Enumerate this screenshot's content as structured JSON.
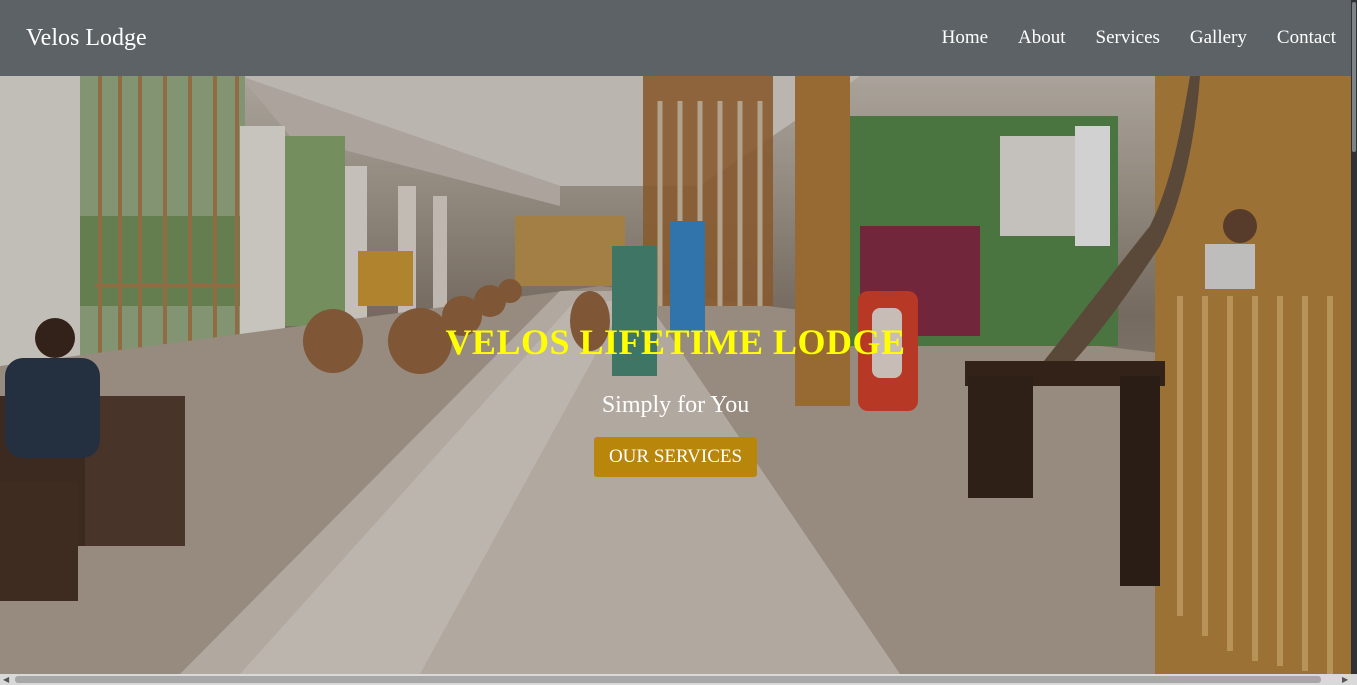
{
  "navbar": {
    "brand": "Velos Lodge",
    "links": [
      "Home",
      "About",
      "Services",
      "Gallery",
      "Contact"
    ]
  },
  "hero": {
    "title": "VELOS LIFETIME LODGE",
    "subtitle": "Simply for You",
    "cta_label": "OUR SERVICES"
  },
  "colors": {
    "navbar": "#5c6266",
    "title": "#ffff00",
    "cta": "#b8860b"
  },
  "icons": {
    "scroll_left": "triangle-left-icon",
    "scroll_right": "triangle-right-icon"
  }
}
